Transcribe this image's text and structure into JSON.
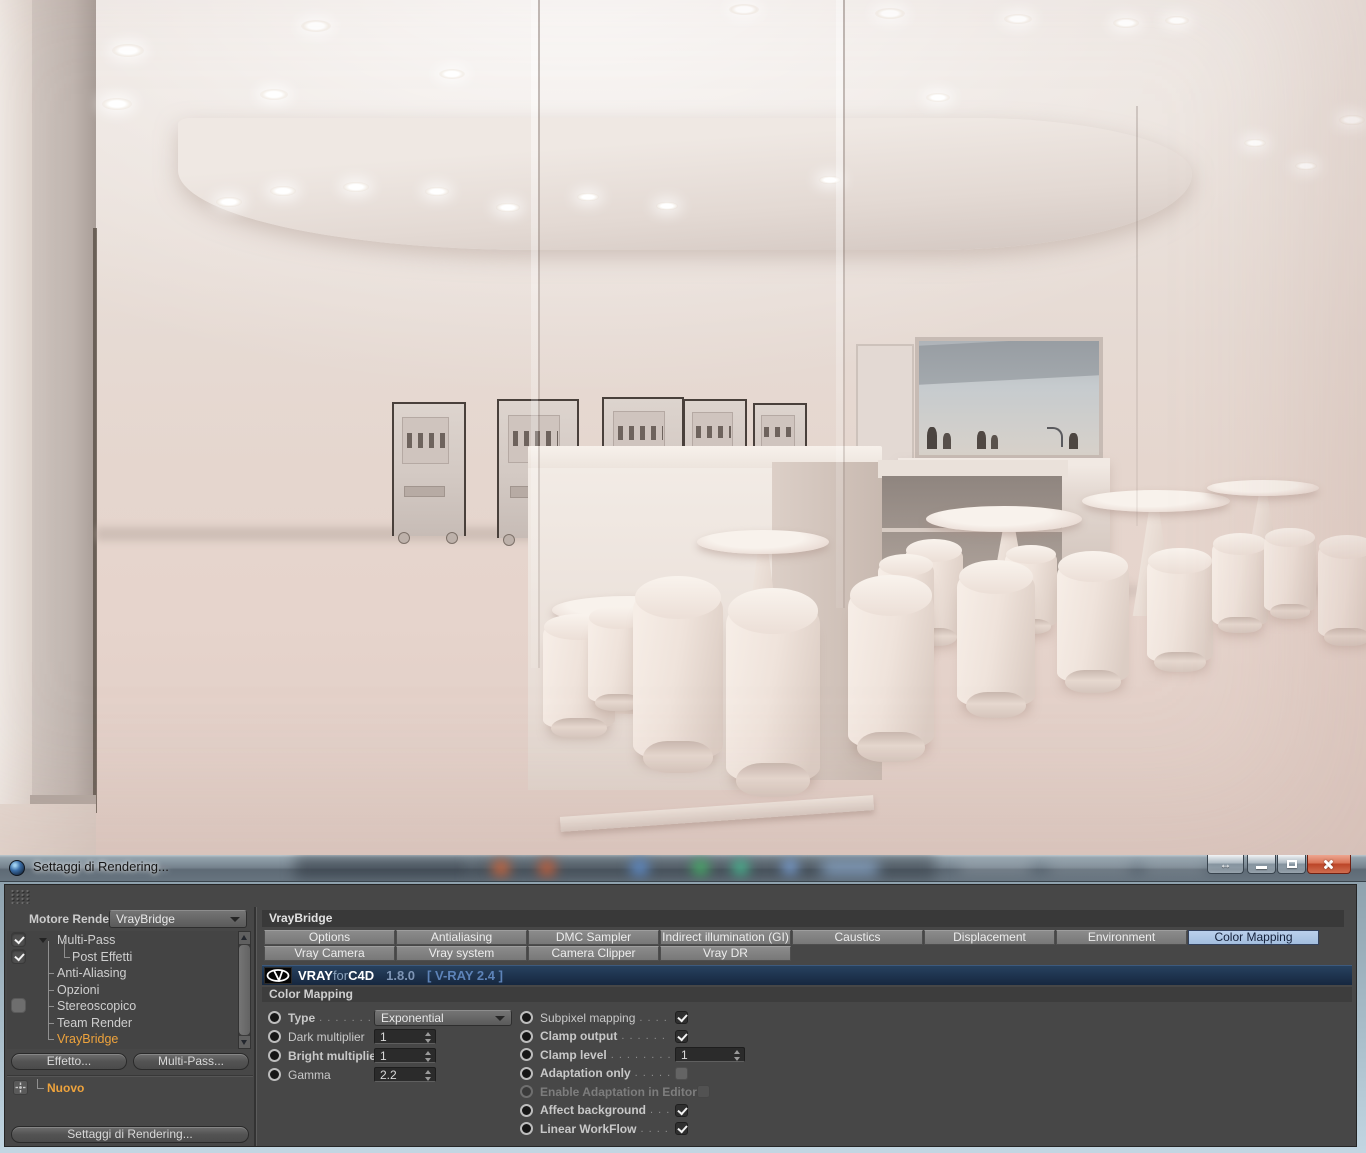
{
  "window": {
    "title": "Settaggi di Rendering...",
    "controls": {
      "resize": "↔",
      "minimize": "minimize",
      "maximize": "maximize",
      "close": "close"
    }
  },
  "left_panel": {
    "engine_label": "Motore Render",
    "engine_value": "VrayBridge",
    "tree": [
      {
        "label": "Multi-Pass",
        "checkbox": "checked",
        "expander": true,
        "indent": 0
      },
      {
        "label": "Post Effetti",
        "checkbox": "checked",
        "indent": 1
      },
      {
        "label": "Anti-Aliasing",
        "indent": 0
      },
      {
        "label": "Opzioni",
        "indent": 0
      },
      {
        "label": "Stereoscopico",
        "checkbox": "unchecked",
        "indent": 0
      },
      {
        "label": "Team Render",
        "indent": 0
      },
      {
        "label": "VrayBridge",
        "selected": true,
        "indent": 0
      }
    ],
    "effetto_button": "Effetto...",
    "multipass_button": "Multi-Pass...",
    "nuovo_label": "Nuovo",
    "bottom_button": "Settaggi di Rendering..."
  },
  "right_panel": {
    "header": "VrayBridge",
    "tabs_row1": [
      "Options",
      "Antialiasing",
      "DMC Sampler",
      "Indirect illumination (GI)",
      "Caustics",
      "Displacement",
      "Environment",
      "Color Mapping"
    ],
    "tabs_row2": [
      "Vray Camera",
      "Vray system",
      "Camera Clipper",
      "Vray DR"
    ],
    "active_tab": "Color Mapping",
    "banner": {
      "brand_vray": "VRAY",
      "brand_for": "for",
      "brand_c4d": "C4D",
      "version": "1.8.0",
      "vray_version": "[ V-RAY 2.4 ]"
    },
    "section_title": "Color Mapping",
    "fields_left": [
      {
        "label": "Type",
        "type": "dropdown",
        "value": "Exponential",
        "bold": true,
        "dots": true
      },
      {
        "label": "Dark multiplier",
        "type": "number",
        "value": "1",
        "bold": false,
        "dots": false
      },
      {
        "label": "Bright multiplier",
        "type": "number",
        "value": "1",
        "bold": true,
        "dots": false
      },
      {
        "label": "Gamma",
        "type": "number",
        "value": "2.2",
        "bold": false,
        "dots": false
      }
    ],
    "fields_right": [
      {
        "label": "Subpixel mapping",
        "type": "checkbox",
        "checked": true,
        "bold": false,
        "dots": true
      },
      {
        "label": "Clamp output",
        "type": "checkbox",
        "checked": true,
        "bold": true,
        "dots": true
      },
      {
        "label": "Clamp level",
        "type": "number",
        "value": "1",
        "bold": true,
        "dots": true
      },
      {
        "label": "Adaptation only",
        "type": "checkbox",
        "checked": false,
        "bold": true,
        "dots": true
      },
      {
        "label": "Enable Adaptation in Editor",
        "type": "checkbox",
        "checked": false,
        "disabled": true,
        "bold": true,
        "dots": false
      },
      {
        "label": "Affect background",
        "type": "checkbox",
        "checked": true,
        "bold": true,
        "dots": true
      },
      {
        "label": "Linear WorkFlow",
        "type": "checkbox",
        "checked": true,
        "bold": true,
        "dots": true
      }
    ]
  },
  "colors": {
    "dialog_bg": "#474747",
    "accent_orange": "#eea33c",
    "active_tab_blue": "#aec6e6",
    "banner_navy": "#1d3450",
    "render_tint": "#e6d5cd"
  }
}
